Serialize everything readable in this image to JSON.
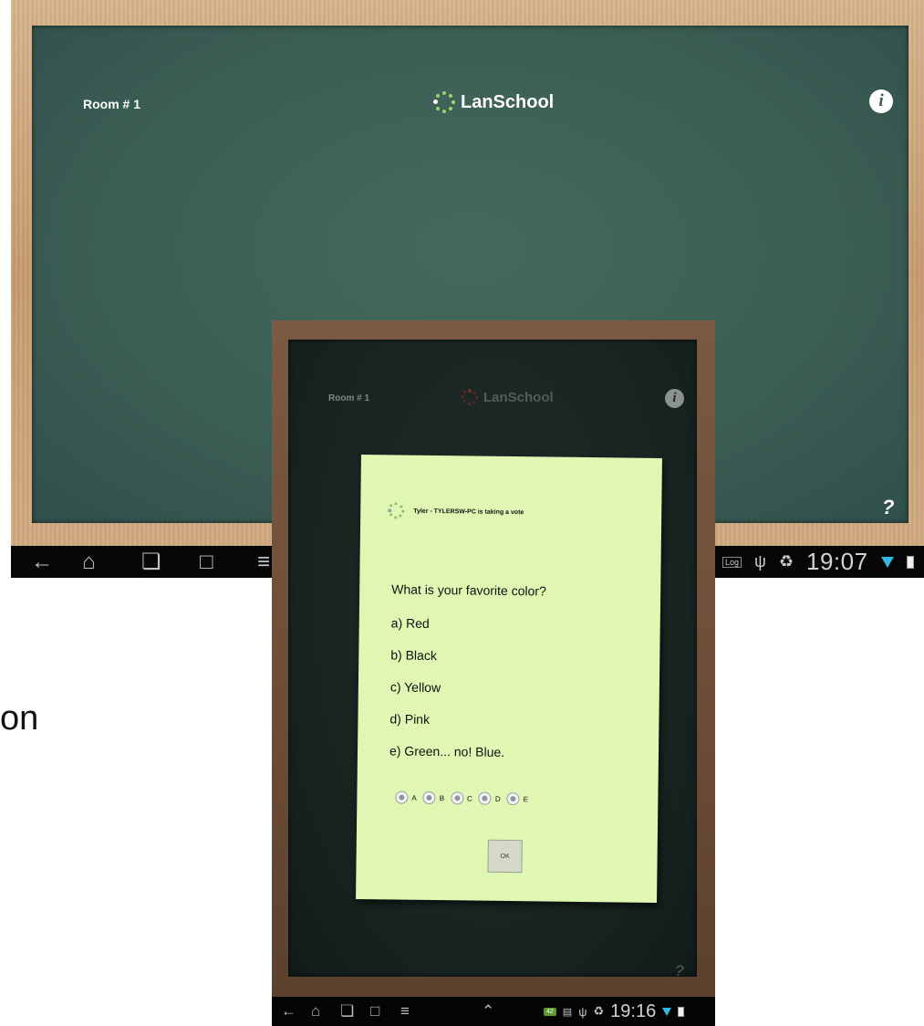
{
  "back_screen": {
    "room_label": "Room # 1",
    "logo_text": "LanSchool",
    "info_icon": "i",
    "help_icon": "?",
    "navbar": {
      "icons": [
        "back-icon",
        "home-icon",
        "recent-apps-icon",
        "screenshot-icon",
        "menu-icon"
      ],
      "status_icons": [
        "log-icon",
        "usb-icon",
        "recycle-icon"
      ],
      "time": "19:07"
    }
  },
  "side_text": "on",
  "front_screen": {
    "room_label": "Room # 1",
    "logo_text": "LanSchool",
    "info_icon": "i",
    "help_icon": "?",
    "vote_dialog": {
      "header": "Tyler - TYLERSW-PC is taking a vote",
      "question": "What is your favorite color?",
      "answers": [
        "a) Red",
        "b) Black",
        "c) Yellow",
        "d) Pink",
        "e) Green... no!  Blue."
      ],
      "options": [
        "A",
        "B",
        "C",
        "D",
        "E"
      ],
      "ok_label": "OK"
    },
    "navbar": {
      "icons": [
        "back-icon",
        "home-icon",
        "recent-apps-icon",
        "screenshot-icon",
        "menu-icon",
        "up-icon"
      ],
      "badge": "42",
      "time": "19:16"
    }
  },
  "colors": {
    "board": "#3c5f55",
    "frame": "#d4ad82",
    "note": "#e0f7b3",
    "signal": "#33b5e5"
  }
}
